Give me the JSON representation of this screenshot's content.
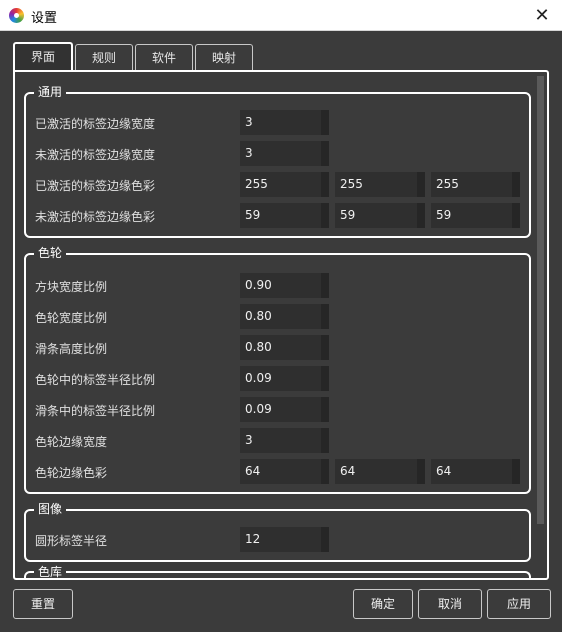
{
  "window": {
    "title": "设置",
    "close_glyph": "✕"
  },
  "tabs": [
    {
      "label": "界面",
      "active": true
    },
    {
      "label": "规则",
      "active": false
    },
    {
      "label": "软件",
      "active": false
    },
    {
      "label": "映射",
      "active": false
    }
  ],
  "general": {
    "title": "通用",
    "active_tag_border_width": {
      "label": "已激活的标签边缘宽度",
      "value": "3"
    },
    "inactive_tag_border_width": {
      "label": "未激活的标签边缘宽度",
      "value": "3"
    },
    "active_tag_border_color": {
      "label": "已激活的标签边缘色彩",
      "r": "255",
      "g": "255",
      "b": "255"
    },
    "inactive_tag_border_color": {
      "label": "未激活的标签边缘色彩",
      "r": "59",
      "g": "59",
      "b": "59"
    }
  },
  "wheel": {
    "title": "色轮",
    "block_width_ratio": {
      "label": "方块宽度比例",
      "value": "0.90"
    },
    "wheel_width_ratio": {
      "label": "色轮宽度比例",
      "value": "0.80"
    },
    "slider_height_ratio": {
      "label": "滑条高度比例",
      "value": "0.80"
    },
    "wheel_tag_radius_ratio": {
      "label": "色轮中的标签半径比例",
      "value": "0.09"
    },
    "slider_tag_radius_ratio": {
      "label": "滑条中的标签半径比例",
      "value": "0.09"
    },
    "wheel_border_width": {
      "label": "色轮边缘宽度",
      "value": "3"
    },
    "wheel_border_color": {
      "label": "色轮边缘色彩",
      "r": "64",
      "g": "64",
      "b": "64"
    }
  },
  "image": {
    "title": "图像",
    "circle_tag_radius": {
      "label": "圆形标签半径",
      "value": "12"
    }
  },
  "depot": {
    "title": "色库"
  },
  "footer": {
    "reset": "重置",
    "ok": "确定",
    "cancel": "取消",
    "apply": "应用"
  },
  "colors": {
    "background": "#3b3b3b",
    "field": "#2f2f2f",
    "border": "#ffffff"
  }
}
